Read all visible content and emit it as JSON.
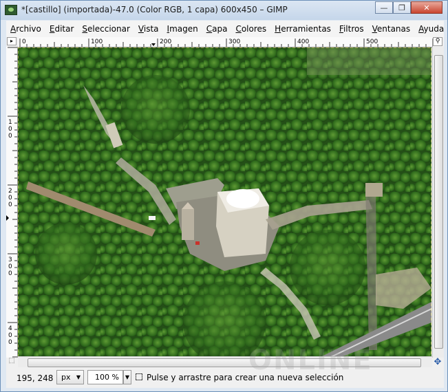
{
  "window": {
    "title": "*[castillo] (importada)-47.0 (Color RGB, 1 capa) 600x450 – GIMP",
    "controls": {
      "minimize": "—",
      "maximize": "❐",
      "close": "✕"
    }
  },
  "menubar": {
    "items": [
      {
        "u": "A",
        "rest": "rchivo"
      },
      {
        "u": "E",
        "rest": "ditar"
      },
      {
        "u": "S",
        "rest": "eleccionar"
      },
      {
        "u": "V",
        "rest": "ista"
      },
      {
        "u": "I",
        "rest": "magen"
      },
      {
        "u": "C",
        "rest": "apa"
      },
      {
        "u": "C",
        "rest": "olores"
      },
      {
        "u": "H",
        "rest": "erramientas"
      },
      {
        "u": "F",
        "rest": "iltros"
      },
      {
        "u": "V",
        "rest": "entanas"
      },
      {
        "u": "A",
        "rest": "yuda"
      }
    ]
  },
  "rulers": {
    "horizontal_labels": [
      "0",
      "100",
      "200",
      "300",
      "400",
      "500"
    ],
    "vertical_labels": [
      "100",
      "200",
      "300",
      "400"
    ]
  },
  "statusbar": {
    "coords": "195, 248",
    "unit": "px",
    "zoom": "100 %",
    "message": "Pulse y arrastre para crear una nueva selección"
  },
  "watermark": "ONLINE",
  "icons": {
    "ruler_corner": "▸",
    "navigate": "✥",
    "quickmask": "⬚"
  }
}
